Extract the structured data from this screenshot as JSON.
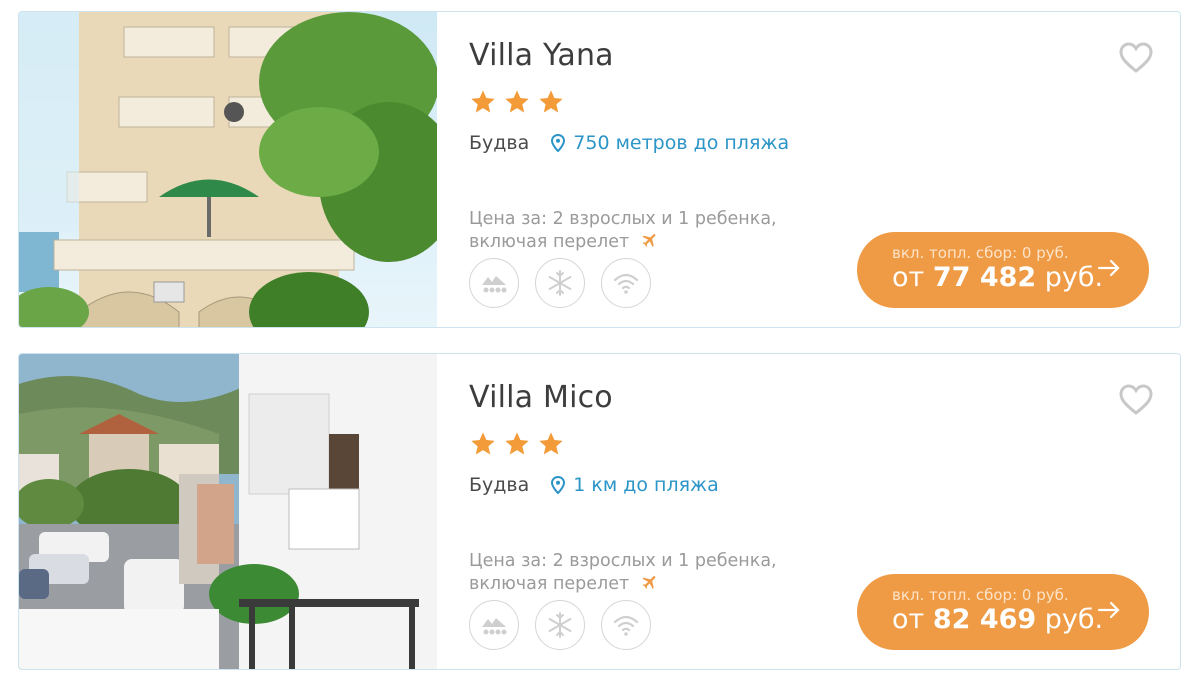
{
  "hotels": [
    {
      "name": "Villa Yana",
      "stars": 3,
      "city": "Будва",
      "beach_distance": "750 метров до пляжа",
      "price_note_line1": "Цена за: 2 взрослых и 1 ребенка,",
      "price_note_line2": "включая перелет",
      "fee_label": "вкл. топл. сбор: 0 руб.",
      "price_prefix": "от",
      "price_amount": "77 482",
      "price_currency": "руб.",
      "amenities": [
        "beach-icon",
        "snowflake-icon",
        "wifi-icon"
      ]
    },
    {
      "name": "Villa Mico",
      "stars": 3,
      "city": "Будва",
      "beach_distance": "1 км до пляжа",
      "price_note_line1": "Цена за: 2 взрослых и 1 ребенка,",
      "price_note_line2": "включая перелет",
      "fee_label": "вкл. топл. сбор: 0 руб.",
      "price_prefix": "от",
      "price_amount": "82 469",
      "price_currency": "руб.",
      "amenities": [
        "beach-icon",
        "snowflake-icon",
        "wifi-icon"
      ]
    }
  ],
  "colors": {
    "accent_orange": "#ef9a44",
    "star": "#f29b38",
    "link_blue": "#2c95c8",
    "card_border": "#cfe3ee",
    "muted_text": "#9a9a9a"
  }
}
